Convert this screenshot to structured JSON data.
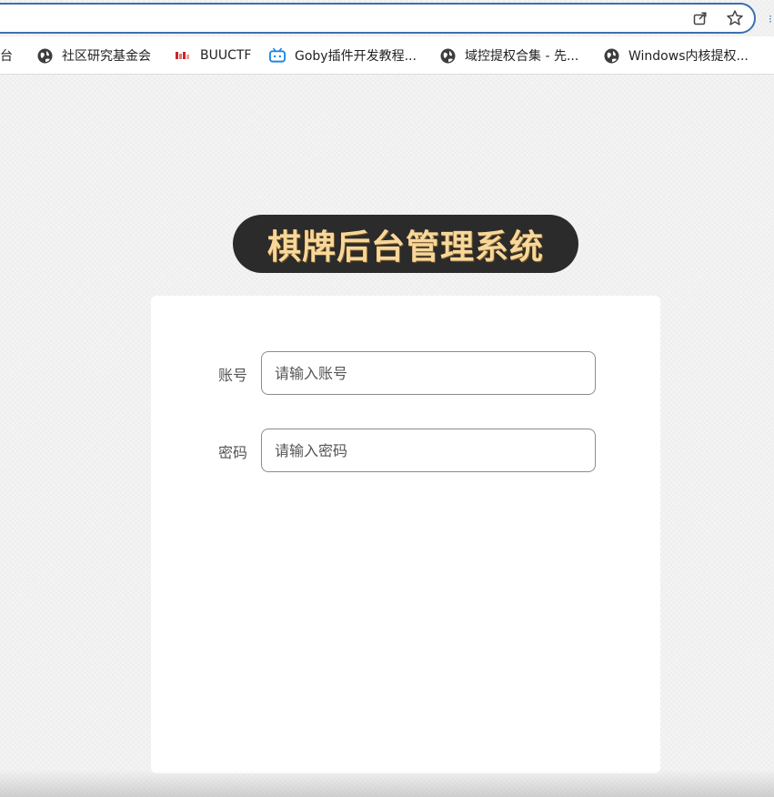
{
  "browser": {
    "bookmarks": [
      {
        "label": "平台",
        "icon": "text-fragment"
      },
      {
        "label": "社区研究基金会",
        "icon": "globe-icon"
      },
      {
        "label": "BUUCTF",
        "icon": "buuctf-logo-icon"
      },
      {
        "label": "Goby插件开发教程...",
        "icon": "bilibili-tv-icon"
      },
      {
        "label": "域控提权合集 - 先...",
        "icon": "globe-icon"
      },
      {
        "label": "Windows内核提权...",
        "icon": "globe-icon"
      }
    ],
    "actions": {
      "share_icon": "share-icon",
      "star_icon": "star-icon"
    },
    "accent_color": "#3c6fb0"
  },
  "login": {
    "title": "棋牌后台管理系统",
    "title_color": "#f7d79a",
    "pill_color": "#2b2b2b",
    "fields": [
      {
        "label": "账号",
        "placeholder": "请输入账号"
      },
      {
        "label": "密码",
        "placeholder": "请输入密码"
      }
    ]
  }
}
